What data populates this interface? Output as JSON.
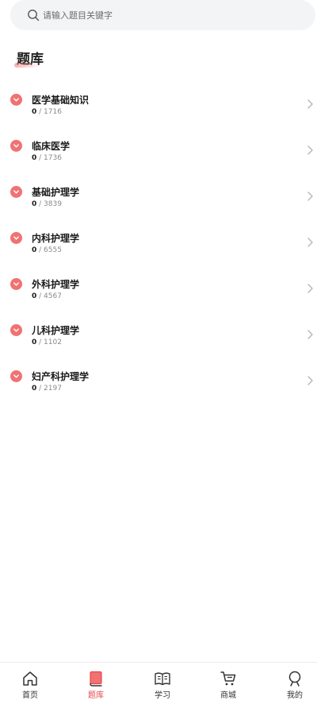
{
  "search": {
    "placeholder": "请输入题目关键字"
  },
  "section": {
    "title": "题库"
  },
  "subjects": [
    {
      "name": "医学基础知识",
      "done": "0",
      "total": "/ 1716"
    },
    {
      "name": "临床医学",
      "done": "0",
      "total": "/ 1736"
    },
    {
      "name": "基础护理学",
      "done": "0",
      "total": "/ 3839"
    },
    {
      "name": "内科护理学",
      "done": "0",
      "total": "/ 6555"
    },
    {
      "name": "外科护理学",
      "done": "0",
      "total": "/ 4567"
    },
    {
      "name": "儿科护理学",
      "done": "0",
      "total": "/ 1102"
    },
    {
      "name": "妇产科护理学",
      "done": "0",
      "total": "/ 2197"
    }
  ],
  "tabbar": {
    "home": "首页",
    "question_bank": "题库",
    "study": "学习",
    "mall": "商城",
    "mine": "我的"
  },
  "colors": {
    "accent": "#e8474b",
    "badge": "#f07272"
  },
  "icons": {
    "search": "search-icon",
    "expand": "chevron-down-icon",
    "row": "chevron-right-icon",
    "home": "home-icon",
    "question_bank": "book-icon",
    "study": "open-book-icon",
    "mall": "cart-icon",
    "mine": "user-icon"
  }
}
